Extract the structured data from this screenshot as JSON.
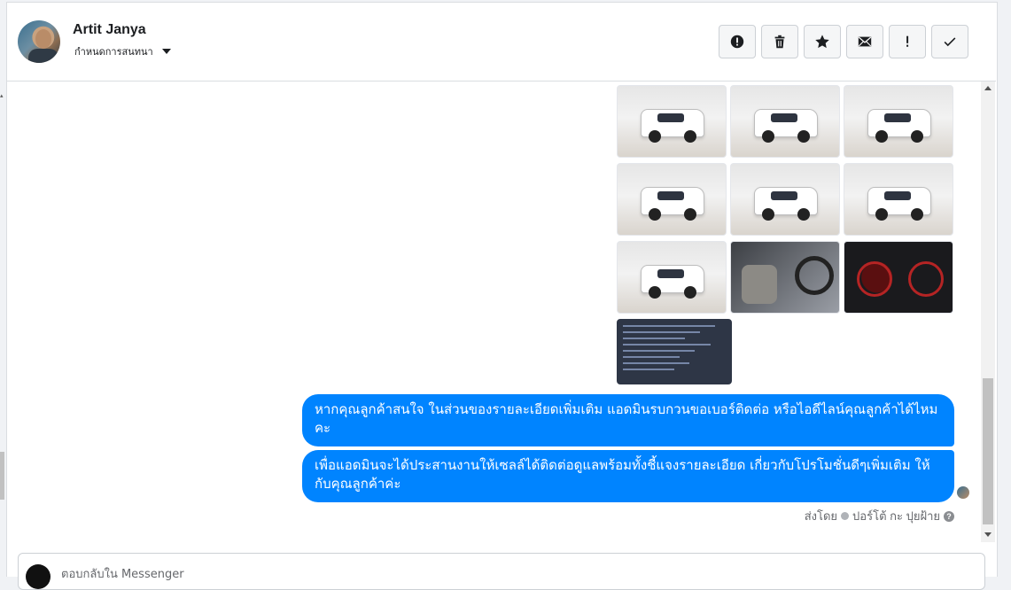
{
  "header": {
    "user_name": "Artit Janya",
    "assign_label": "กำหนดการสนทนา"
  },
  "actions": [
    {
      "name": "spam",
      "icon": "alert-circle-icon"
    },
    {
      "name": "delete",
      "icon": "trash-icon"
    },
    {
      "name": "star",
      "icon": "star-icon"
    },
    {
      "name": "mark-unread",
      "icon": "envelope-icon"
    },
    {
      "name": "important",
      "icon": "exclamation-icon"
    },
    {
      "name": "done",
      "icon": "checkmark-icon"
    }
  ],
  "gallery": {
    "photos": [
      "car-front-angle",
      "car-front",
      "car-rear-angle",
      "car-rear",
      "car-rear-side",
      "car-side",
      "car-side-left",
      "car-interior",
      "instrument-cluster",
      "spec-sheet"
    ]
  },
  "messages": [
    {
      "text": "หากคุณลูกค้าสนใจ ในส่วนของรายละเอียดเพิ่มเติม แอดมินรบกวนขอเบอร์ติดต่อ หรือไอดีไลน์คุณลูกค้าได้ไหมคะ"
    },
    {
      "text": "เพื่อแอดมินจะได้ประสานงานให้เซลล์ได้ติดต่อดูแลพร้อมทั้งชี้แจงรายละเอียด เกี่ยวกับโปรโมชั่นดีๆเพิ่มเติม ให้กับคุณลูกค้าค่ะ"
    }
  ],
  "sent_by": {
    "prefix": "ส่งโดย",
    "name": "ปอร์โต้ กะ ปุยฝ้าย",
    "help": "?"
  },
  "composer": {
    "placeholder": "ตอบกลับใน Messenger"
  },
  "colors": {
    "bubble": "#0084ff",
    "muted_text": "#65676b"
  }
}
